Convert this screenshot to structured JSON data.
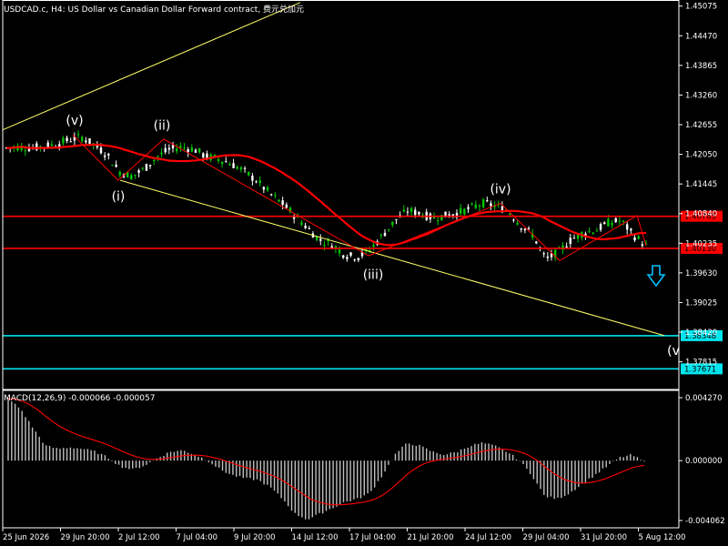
{
  "window": {
    "title": "USDCAD.c, H4:  US Dollar vs Canadian Dollar Forward contract, 费元兑加元"
  },
  "macd_panel": {
    "title": "MACD(12,26,9) -0.000066 -0.000057"
  },
  "colors": {
    "background": "#000000",
    "axis": "#ffffff",
    "bull_candle": "#00c800",
    "bear_candle": "#ffffff",
    "moving_average": "#ff0000",
    "resistance": "#ff0000",
    "target": "#00e5ee",
    "trendline": "#ffff66",
    "wave_line": "#ff0000",
    "arrow": "#00bfff",
    "histogram": "#c0c0c0",
    "signal": "#ff0000"
  },
  "chart_data": [
    {
      "type": "candlestick",
      "symbol": "USDCAD.c",
      "timeframe": "H4",
      "ylim": [
        1.3725,
        1.452
      ],
      "y_ticks": [
        "1.45075",
        "1.44470",
        "1.43865",
        "1.43260",
        "1.42655",
        "1.42050",
        "1.41445",
        "1.40840",
        "1.40235",
        "1.39630",
        "1.39025",
        "1.38420",
        "1.37815"
      ],
      "x_ticks": [
        "25 Jun 2026",
        "29 Jun 20:00",
        "2 Jul 12:00",
        "7 Jul 04:00",
        "9 Jul 20:00",
        "14 Jul 12:00",
        "17 Jul 04:00",
        "21 Jul 20:00",
        "24 Jul 12:00",
        "29 Jul 04:00",
        "31 Jul 20:00",
        "5 Aug 12:00"
      ],
      "price_path": [
        1.4218,
        1.422,
        1.4218,
        1.4222,
        1.4225,
        1.4235,
        1.424,
        1.4225,
        1.4205,
        1.417,
        1.416,
        1.4175,
        1.42,
        1.4215,
        1.422,
        1.4215,
        1.42,
        1.4195,
        1.4185,
        1.417,
        1.415,
        1.4125,
        1.4105,
        1.408,
        1.4055,
        1.403,
        1.402,
        1.4,
        1.3995,
        1.401,
        1.404,
        1.407,
        1.409,
        1.4085,
        1.4075,
        1.408,
        1.4085,
        1.4095,
        1.4105,
        1.41,
        1.409,
        1.406,
        1.404,
        1.399,
        1.4005,
        1.403,
        1.4045,
        1.405,
        1.4065,
        1.407,
        1.404,
        1.4018
      ],
      "horizontal_levels": [
        {
          "label": "1.40785",
          "value": 1.40785,
          "kind": "resistance"
        },
        {
          "label": "1.40130",
          "value": 1.4013,
          "kind": "resistance"
        },
        {
          "label": "1.38348",
          "value": 1.38348,
          "kind": "target"
        },
        {
          "label": "1.37671",
          "value": 1.37671,
          "kind": "target"
        }
      ],
      "wave_labels": [
        "(v)",
        "(ii)",
        "(i)",
        "(iv)",
        "(iii)",
        "(v"
      ]
    },
    {
      "type": "bar",
      "name": "MACD(12,26,9)",
      "main_value": -6.6e-05,
      "signal_value": -5.7e-05,
      "ylim": [
        -0.004062,
        0.00427
      ],
      "y_ticks": [
        "0.004270",
        "0.000000",
        "-0.004062"
      ],
      "histogram_path": [
        0.0042,
        0.0035,
        0.0022,
        0.001,
        0.0008,
        0.0009,
        0.0008,
        0.0006,
        0.0002,
        -0.0004,
        -0.0006,
        -0.0003,
        0.0002,
        0.0006,
        0.0007,
        0.0004,
        0.0,
        -0.0006,
        -0.001,
        -0.0012,
        -0.0013,
        -0.0018,
        -0.0026,
        -0.0036,
        -0.004,
        -0.0036,
        -0.0032,
        -0.0028,
        -0.0026,
        -0.0022,
        -0.001,
        0.0004,
        0.0012,
        0.001,
        0.0006,
        0.0004,
        0.0006,
        0.001,
        0.0012,
        0.001,
        0.0006,
        0.0,
        -0.001,
        -0.0024,
        -0.0026,
        -0.0022,
        -0.0016,
        -0.001,
        -0.0004,
        0.0002,
        0.0004,
        -0.0001
      ]
    }
  ]
}
